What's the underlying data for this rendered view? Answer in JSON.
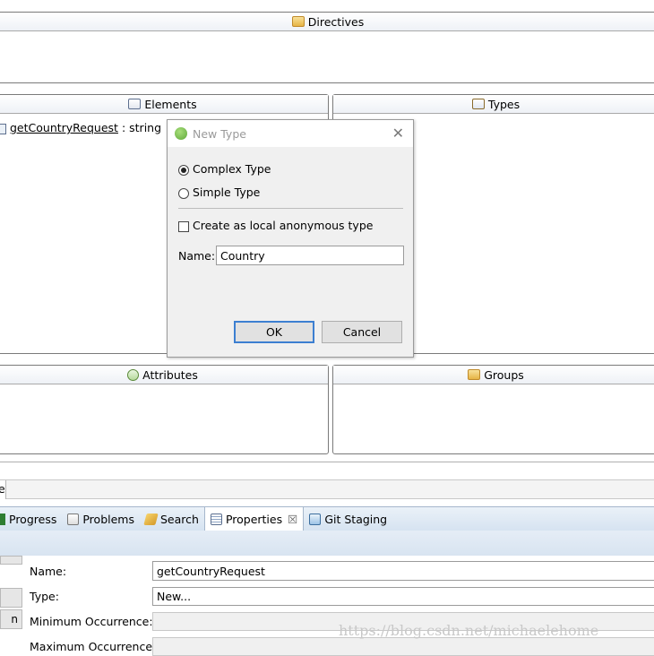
{
  "directives": {
    "title": "Directives"
  },
  "elements": {
    "title": "Elements",
    "items": [
      {
        "name": "getCountryRequest",
        "type": ": string"
      }
    ]
  },
  "types": {
    "title": "Types"
  },
  "attributes": {
    "title": "Attributes"
  },
  "groups": {
    "title": "Groups"
  },
  "dialog": {
    "title": "New Type",
    "close": "✕",
    "complex_type": "Complex Type",
    "simple_type": "Simple Type",
    "selected": "Complex Type",
    "anonymous_label": "Create as local anonymous type",
    "anonymous_checked": false,
    "name_label": "Name:",
    "name_value": "Country",
    "ok": "OK",
    "cancel": "Cancel"
  },
  "editor_tab_fragment": "e",
  "bottom_tabs": [
    {
      "label": "Progress",
      "icon": "progress-icon"
    },
    {
      "label": "Problems",
      "icon": "problems-icon"
    },
    {
      "label": "Search",
      "icon": "search-icon"
    },
    {
      "label": "Properties",
      "icon": "properties-icon",
      "active": true,
      "close": "☒"
    },
    {
      "label": "Git Staging",
      "icon": "git-staging-icon"
    }
  ],
  "properties": {
    "side_button_label": "n",
    "rows": [
      {
        "label": "Name:",
        "value": "getCountryRequest"
      },
      {
        "label": "Type:",
        "value": "New..."
      },
      {
        "label": "Minimum Occurrence:",
        "value": ""
      },
      {
        "label": "Maximum Occurrence:",
        "value": ""
      }
    ]
  },
  "watermark": "https://blog.csdn.net/michaelehome"
}
